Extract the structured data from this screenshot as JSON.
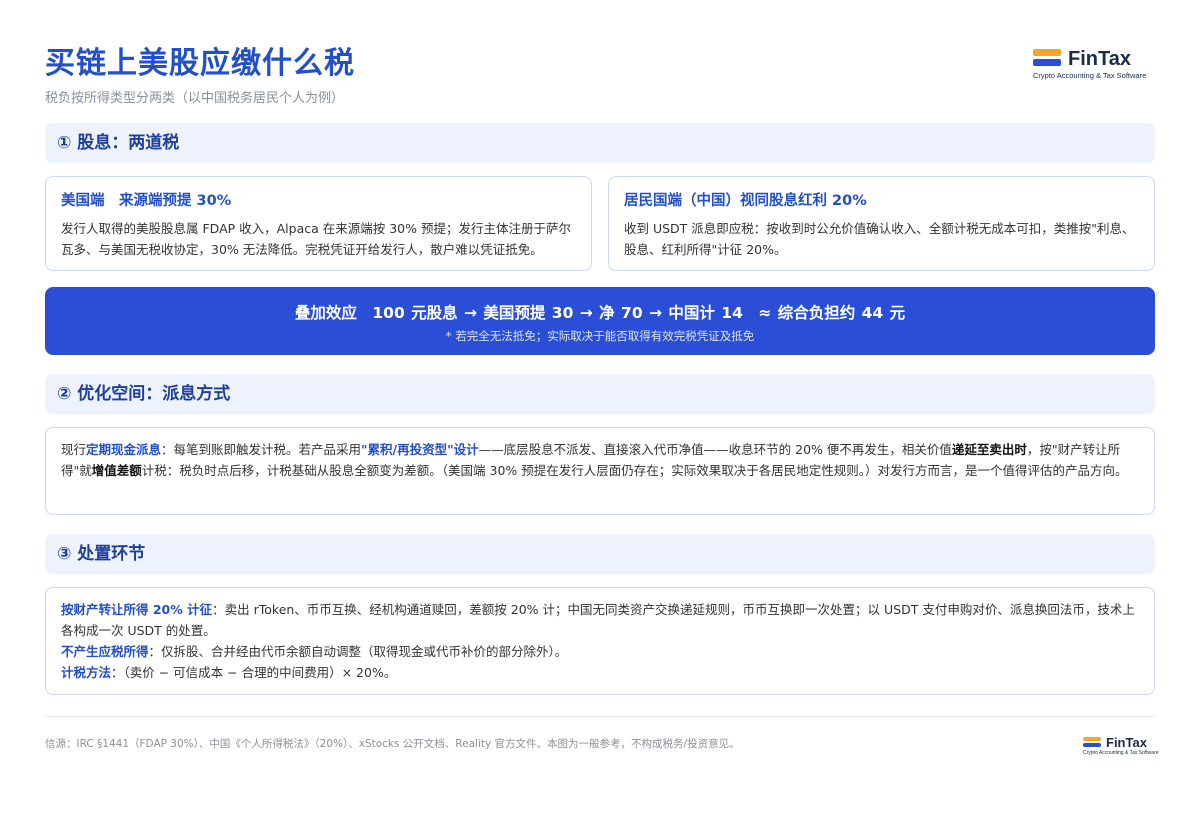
{
  "header": {
    "title": "买链上美股应缴什么税",
    "subtitle": "税负按所得类型分两类（以中国税务居民个人为例）"
  },
  "logo": {
    "word": "FinTax",
    "tagline": "Crypto Accounting & Tax Software"
  },
  "section1": {
    "heading": "① 股息：两道税",
    "card_us": {
      "title": "美国端　来源端预提 30%",
      "body": "发行人取得的美股股息属 FDAP 收入，Alpaca 在来源端按 30% 预提；发行主体注册于萨尔瓦多、与美国无税收协定，30% 无法降低。完税凭证开给发行人，散户难以凭证抵免。"
    },
    "card_cn": {
      "title": "居民国端（中国）视同股息红利 20%",
      "body": "收到 USDT 派息即应税：按收到时公允价值确认收入、全额计税无成本可扣，类推按\"利息、股息、红利所得\"计征 20%。"
    }
  },
  "banner": {
    "main": "叠加效应　100 元股息 → 美国预提 30 → 净 70 → 中国计 14　≈ 综合负担约 44 元",
    "note": "* 若完全无法抵免；实际取决于能否取得有效完税凭证及抵免"
  },
  "section2": {
    "heading": "② 优化空间：派息方式",
    "p1": "现行",
    "h1": "定期现金派息",
    "p2": "：每笔到账即触发计税。若产品采用",
    "h2": "\"累积/再投资型\"设计",
    "p3": "——底层股息不派发、直接滚入代币净值——收息环节的 20% 便不再发生，相关价值",
    "b1": "递延至卖出时",
    "p4": "，按\"财产转让所得\"就",
    "b2": "增值差额",
    "p5": "计税：税负时点后移，计税基础从股息全额变为差额。（美国端 30% 预提在发行人层面仍存在；实际效果取决于各居民地定性规则。）对发行方而言，是一个值得评估的产品方向。"
  },
  "section3": {
    "heading": "③ 处置环节",
    "l1_label": "按财产转让所得 20% 计征",
    "l1_text": "：卖出 rToken、币币互换、经机构通道赎回，差额按 20% 计；中国无同类资产交换递延规则，币币互换即一次处置；以 USDT 支付申购对价、派息换回法币，技术上各构成一次 USDT 的处置。",
    "l2_label": "不产生应税所得",
    "l2_text": "：仅拆股、合并经由代币余额自动调整（取得现金或代币补价的部分除外）。",
    "l3_label": "计税方法",
    "l3_text": "：（卖价 − 可信成本 − 合理的中间费用）× 20%。"
  },
  "footer": {
    "source": "信源：IRC §1441（FDAP 30%）、中国《个人所得税法》（20%）、xStocks 公开文档、Reality 官方文件。本图为一般参考，不构成税务/投资意见。"
  },
  "colors": {
    "accent": "#2350c9",
    "banner": "#2a4fd6",
    "section_bg": "#edf2fc",
    "logo_orange": "#f5a623"
  }
}
